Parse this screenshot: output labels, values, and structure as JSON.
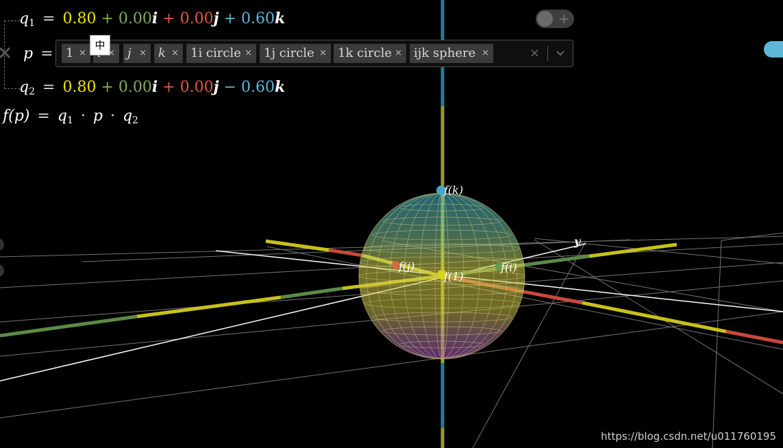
{
  "equations": {
    "q1": {
      "name": "q",
      "sub": "1",
      "eq": "=",
      "w": "0.80",
      "p1": "+",
      "xi": "0.00",
      "i": "i",
      "p2": "+",
      "xj": "0.00",
      "j": "j",
      "p3": "+",
      "xk": "0.60",
      "k": "k"
    },
    "p": {
      "name": "p",
      "eq": "="
    },
    "q2": {
      "name": "q",
      "sub": "2",
      "eq": "=",
      "w": "0.80",
      "p1": "+",
      "xi": "0.00",
      "i": "i",
      "p2": "+",
      "xj": "0.00",
      "j": "j",
      "p3": "−",
      "xk": "0.60",
      "k": "k"
    },
    "f": {
      "lhs": "f(p)",
      "eq": "=",
      "q1": "q",
      "q1sub": "1",
      "dot1": "·",
      "p": "p",
      "dot2": "·",
      "q2": "q",
      "q2sub": "2"
    }
  },
  "selector": {
    "chips": [
      {
        "label": "1",
        "remove": "×"
      },
      {
        "label": "i",
        "remove": "×"
      },
      {
        "label": "j",
        "remove": "×"
      },
      {
        "label": "k",
        "remove": "×"
      },
      {
        "label": "1i circle",
        "remove": "×"
      },
      {
        "label": "1j circle",
        "remove": "×"
      },
      {
        "label": "1k circle",
        "remove": "×"
      },
      {
        "label": "ijk sphere",
        "remove": "×"
      }
    ],
    "clear": "×",
    "dropdown_icon": "chevron-down-icon"
  },
  "ime_indicator": "中",
  "toggle": {
    "plus": "+"
  },
  "scene": {
    "axis_label_y": "y",
    "point_labels": {
      "fk": "f(k)",
      "fj": "f(j)",
      "fi": "f(i)",
      "f1": "f(1)"
    }
  },
  "colors": {
    "yellow": "#f2e600",
    "green": "#7fb062",
    "red": "#e05a43",
    "blue": "#5fb7d8"
  },
  "watermark": "https://blog.csdn.net/u011760195"
}
